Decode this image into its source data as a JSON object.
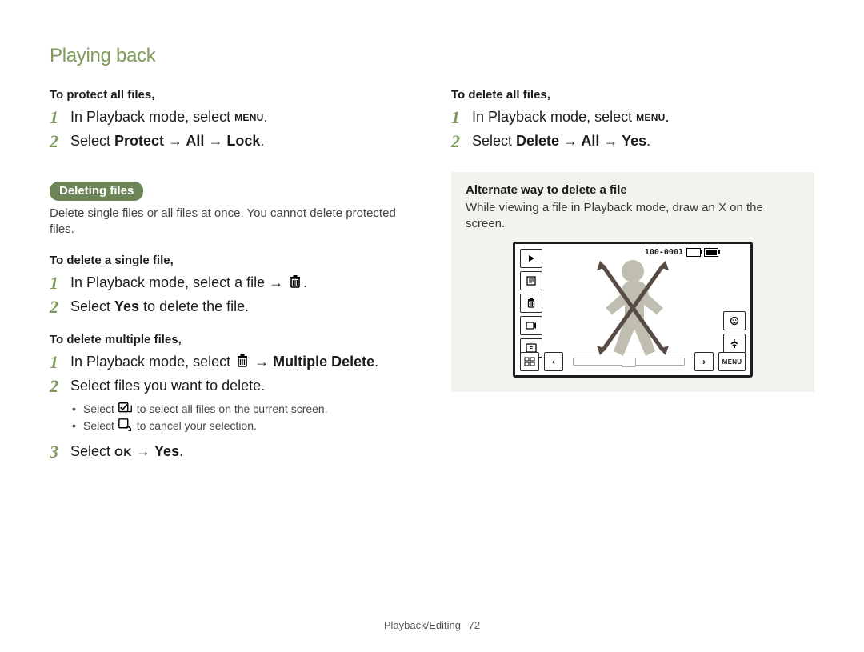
{
  "header": {
    "title": "Playing back"
  },
  "left": {
    "protect_all": {
      "heading": "To protect all files,",
      "steps": [
        {
          "pre": "In Playback mode, select ",
          "icon": "menu",
          "post": "."
        },
        {
          "pre": "Select ",
          "strong": "Protect → All → Lock",
          "post": "."
        }
      ]
    },
    "deleting": {
      "pill": "Deleting files",
      "desc": "Delete single files or all files at once. You cannot delete protected files."
    },
    "delete_single": {
      "heading": "To delete a single file,",
      "steps": [
        {
          "pre": "In Playback mode, select a file → ",
          "icon": "trash",
          "post": "."
        },
        {
          "pre": "Select ",
          "strong": "Yes",
          "post": " to delete the file."
        }
      ]
    },
    "delete_multi": {
      "heading": "To delete multiple files,",
      "steps": [
        {
          "pre": "In Playback mode, select ",
          "icon": "trash",
          "post": " → ",
          "strong": "Multiple Delete",
          "post2": "."
        },
        {
          "pre": "Select files you want to delete.",
          "subs": [
            {
              "pre": "Select ",
              "icon": "check-all",
              "post": " to select all files on the current screen."
            },
            {
              "pre": "Select ",
              "icon": "cancel-sel",
              "post": " to cancel your selection."
            }
          ]
        },
        {
          "pre": "Select ",
          "icon": "ok",
          "post": " → ",
          "strong": "Yes",
          "post2": "."
        }
      ]
    }
  },
  "right": {
    "delete_all": {
      "heading": "To delete all files,",
      "steps": [
        {
          "pre": "In Playback mode, select ",
          "icon": "menu",
          "post": "."
        },
        {
          "pre": "Select ",
          "strong": "Delete → All → Yes",
          "post": "."
        }
      ]
    },
    "tip": {
      "heading": "Alternate way to delete a file",
      "desc": "While viewing a file in Playback mode, draw an X on the screen."
    },
    "lcd": {
      "file_no": "100-0001",
      "left_icons": [
        "play",
        "info",
        "trash",
        "rec",
        "sd"
      ],
      "right_icons": [
        "face",
        "wifi"
      ],
      "bottom_left": "thumb",
      "bottom_nav": [
        "‹",
        "›"
      ],
      "bottom_menu": "MENU"
    }
  },
  "footer": {
    "section": "Playback/Editing",
    "page": "72"
  },
  "glyphs": {
    "menu": "MENU",
    "ok": "OK"
  }
}
